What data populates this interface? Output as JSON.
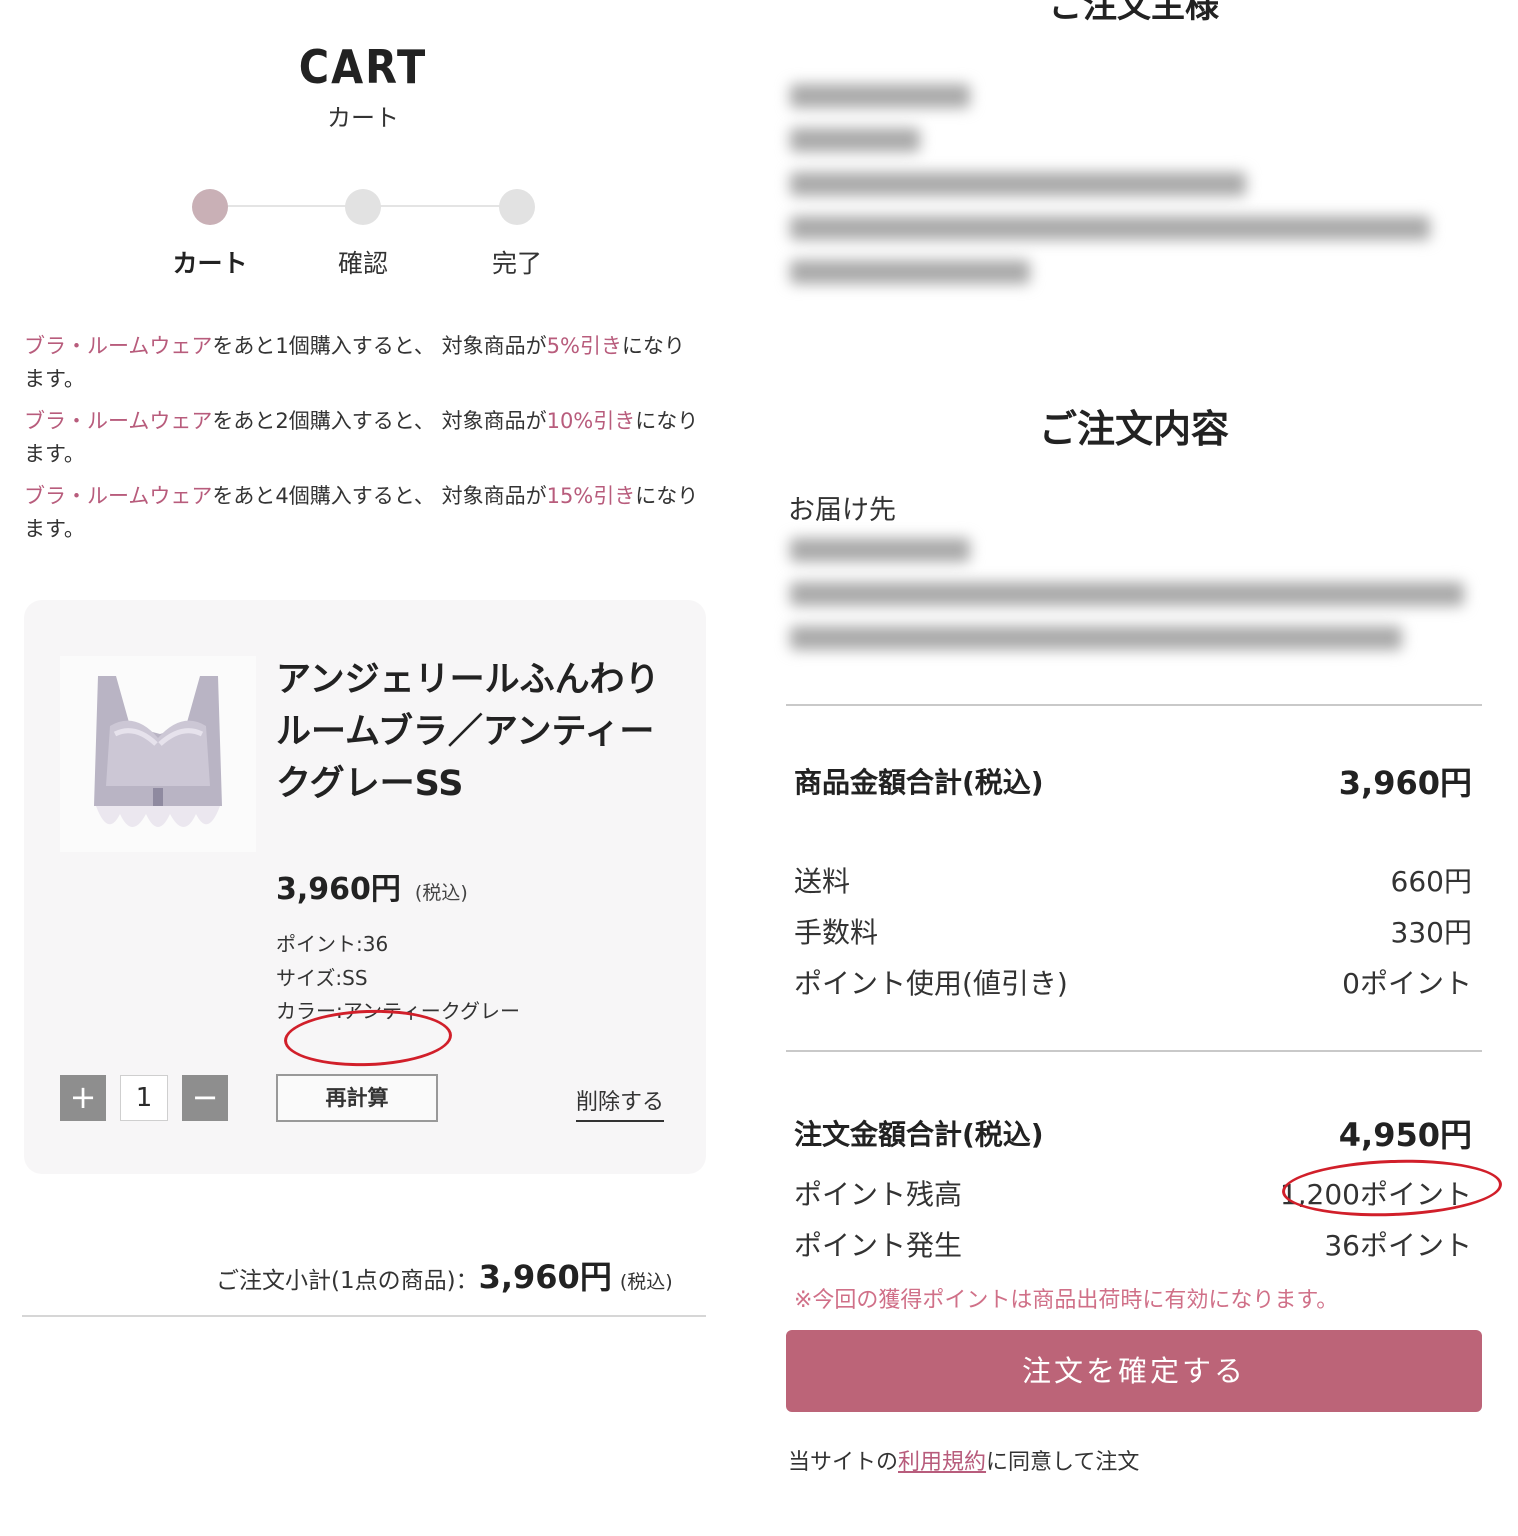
{
  "cart": {
    "title": "CART",
    "subtitle": "カート",
    "steps": [
      {
        "label": "カート"
      },
      {
        "label": "確認"
      },
      {
        "label": "完了"
      }
    ],
    "promos": [
      {
        "category": "ブラ・ルームウェア",
        "mid": "をあと1個購入すると、 対象商品が",
        "discount": "5%引き",
        "end": "になり",
        "tail": "ます。"
      },
      {
        "category": "ブラ・ルームウェア",
        "mid": "をあと2個購入すると、 対象商品が",
        "discount": "10%引き",
        "end": "になり",
        "tail": "ます。"
      },
      {
        "category": "ブラ・ルームウェア",
        "mid": "をあと4個購入すると、 対象商品が",
        "discount": "15%引き",
        "end": "になり",
        "tail": "ます。"
      }
    ],
    "item": {
      "name_lines": [
        "アンジェリールふんわり",
        "ルームブラ／アンティー",
        "クグレーSS"
      ],
      "price": "3,960円",
      "tax_note": "(税込)",
      "points": "ポイント:36",
      "size": "サイズ:SS",
      "color": "カラー:アンティークグレー",
      "quantity": "1",
      "plus": "+",
      "minus": "−",
      "recalc_label": "再計算",
      "delete_label": "削除する"
    },
    "subtotal": {
      "label": "ご注文小計(1点の商品)：",
      "amount": "3,960円",
      "tax_note": "(税込)"
    }
  },
  "order": {
    "orderer_title": "ご注文主様",
    "section_title": "ご注文内容",
    "delivery_label": "お届け先",
    "rows": {
      "product_total": {
        "label": "商品金額合計(税込)",
        "value": "3,960円"
      },
      "shipping": {
        "label": "送料",
        "value": "660円"
      },
      "fee": {
        "label": "手数料",
        "value": "330円"
      },
      "points_used": {
        "label": "ポイント使用(値引き)",
        "value": "0ポイント"
      },
      "order_total": {
        "label": "注文金額合計(税込)",
        "value": "4,950円"
      },
      "point_balance": {
        "label": "ポイント残高",
        "value": "1,200ポイント"
      },
      "points_earned": {
        "label": "ポイント発生",
        "value": "36ポイント"
      }
    },
    "note": "※今回の獲得ポイントは商品出荷時に有効になります。",
    "confirm_label": "注文を確定する",
    "agree": {
      "prefix": "当サイトの",
      "link": "利用規約",
      "suffix": "に同意して注文"
    }
  },
  "colors": {
    "accent": "#b85c7c",
    "button": "#bc6478",
    "step_active": "#c9b0b6",
    "annotation": "#d11f2a"
  }
}
